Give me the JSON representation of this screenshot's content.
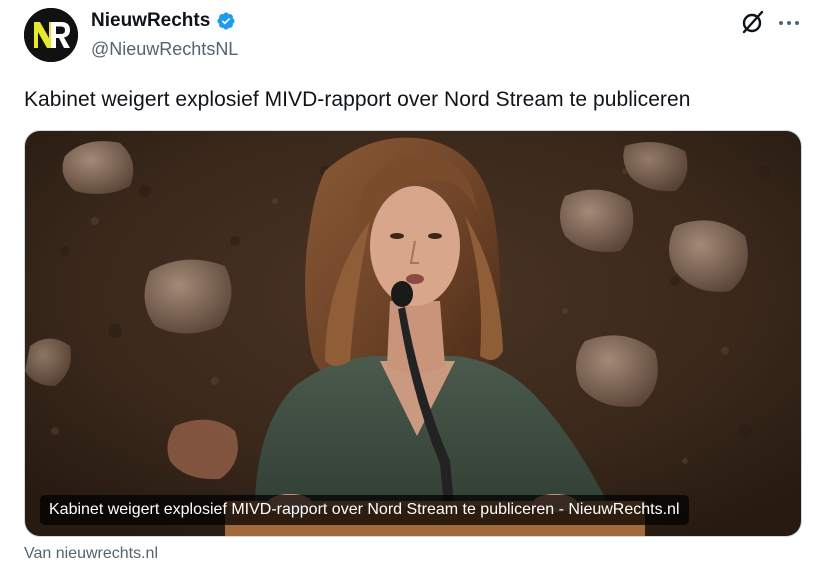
{
  "author": {
    "display_name": "NieuwRechts",
    "handle": "@NieuwRechtsNL",
    "avatar_text": "NR",
    "verified": true
  },
  "tweet": {
    "text": "Kabinet weigert explosief MIVD-rapport over Nord Stream te publiceren"
  },
  "card": {
    "caption": "Kabinet weigert explosief MIVD-rapport over Nord Stream te publiceren - NieuwRechts.nl",
    "source": "Van nieuwrechts.nl"
  },
  "icons": {
    "verified": "verified-badge-icon",
    "grok": "grok-icon",
    "more": "more-dots-icon"
  },
  "colors": {
    "verified_blue": "#1d9bf0",
    "avatar_yellow": "#e8e82c",
    "text_primary": "#0f1419",
    "text_secondary": "#536471"
  }
}
